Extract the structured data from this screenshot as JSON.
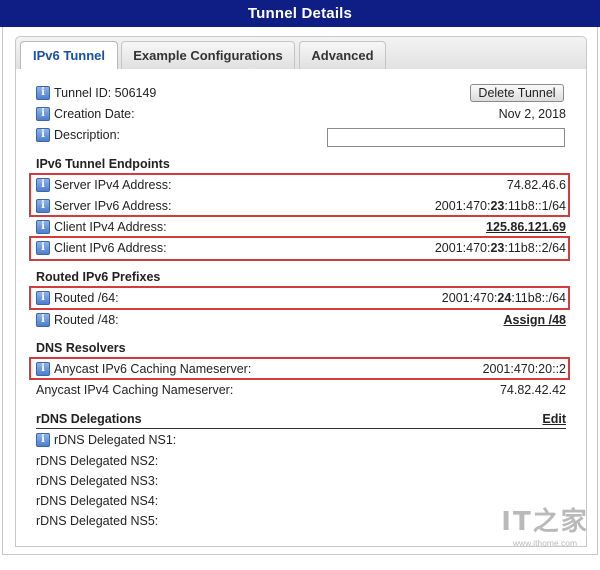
{
  "window": {
    "title": "Tunnel Details"
  },
  "tabs": [
    {
      "label": "IPv6 Tunnel",
      "active": true
    },
    {
      "label": "Example Configurations",
      "active": false
    },
    {
      "label": "Advanced",
      "active": false
    }
  ],
  "general": {
    "tunnel_id": {
      "label": "Tunnel ID: 506149"
    },
    "delete_button": "Delete Tunnel",
    "creation_date": {
      "label": "Creation Date:",
      "value": "Nov 2, 2018"
    },
    "description": {
      "label": "Description:",
      "value": ""
    }
  },
  "endpoints": {
    "heading": "IPv6 Tunnel Endpoints",
    "server_ipv4": {
      "label": "Server IPv4 Address:",
      "value": "74.82.46.6"
    },
    "server_ipv6": {
      "label": "Server IPv6 Address:",
      "prefix": "2001:470:",
      "bold": "23",
      "suffix": ":11b8::1/64"
    },
    "client_ipv4": {
      "label": "Client IPv4 Address:",
      "value": "125.86.121.69"
    },
    "client_ipv6": {
      "label": "Client IPv6 Address:",
      "prefix": "2001:470:",
      "bold": "23",
      "suffix": ":11b8::2/64"
    }
  },
  "routed": {
    "heading": "Routed IPv6 Prefixes",
    "routed_64": {
      "label": "Routed /64:",
      "prefix": "2001:470:",
      "bold": "24",
      "suffix": ":11b8::/64"
    },
    "routed_48": {
      "label": "Routed /48:",
      "link": "Assign /48"
    }
  },
  "dns": {
    "heading": "DNS Resolvers",
    "anycast_ipv6": {
      "label": "Anycast IPv6 Caching Nameserver:",
      "value": "2001:470:20::2"
    },
    "anycast_ipv4": {
      "label": "Anycast IPv4 Caching Nameserver:",
      "value": "74.82.42.42"
    }
  },
  "rdns": {
    "heading": "rDNS Delegations",
    "edit_link": "Edit",
    "ns": [
      "rDNS Delegated NS1:",
      "rDNS Delegated NS2:",
      "rDNS Delegated NS3:",
      "rDNS Delegated NS4:",
      "rDNS Delegated NS5:"
    ]
  },
  "watermark": {
    "logo": "IT之家",
    "url": "www.ithome.com"
  },
  "colors": {
    "title_bar": "#0f1e85",
    "highlight": "#d23c3c",
    "active_tab_text": "#1a4fa8"
  },
  "icons": {
    "info": "info-icon"
  }
}
